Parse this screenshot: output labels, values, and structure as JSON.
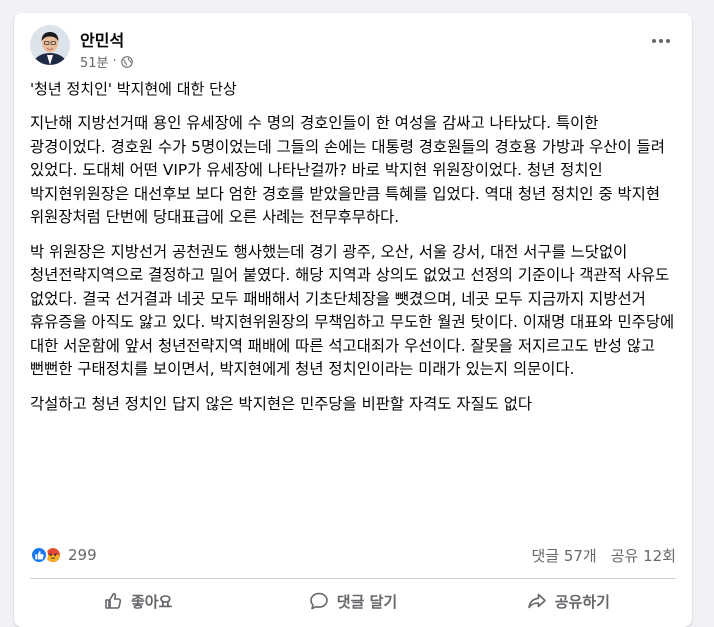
{
  "post": {
    "author": "안민석",
    "time": "51분",
    "separator": "·",
    "title": "'청년 정치인' 박지현에 대한 단상",
    "paragraphs": [
      "지난해 지방선거때 용인 유세장에 수 명의 경호인들이 한 여성을 감싸고 나타났다. 특이한 광경이었다. 경호원 수가 5명이었는데 그들의 손에는 대통령 경호원들의 경호용 가방과 우산이 들려 있었다. 도대체 어떤 VIP가 유세장에 나타난걸까? 바로 박지현 위원장이었다. 청년 정치인 박지현위원장은 대선후보 보다 엄한 경호를 받았을만큼 특혜를 입었다. 역대 청년 정치인 중 박지현 위원장처럼 단번에 당대표급에 오른 사례는 전무후무하다.",
      "박 위원장은 지방선거 공천권도 행사했는데 경기 광주, 오산, 서울 강서, 대전 서구를 느닷없이 청년전략지역으로 결정하고 밀어 붙였다. 해당 지역과 상의도 없었고 선정의 기준이나 객관적 사유도 없었다. 결국 선거결과 네곳 모두 패배해서 기초단체장을 뺏겼으며, 네곳 모두 지금까지 지방선거 휴유증을 아직도 앓고 있다. 박지현위원장의 무책임하고 무도한 월권 탓이다. 이재명 대표와 민주당에 대한 서운함에 앞서 청년전략지역 패배에 따른 석고대죄가 우선이다. 잘못을 저지르고도 반성 않고 뻔뻔한 구태정치를 보이면서, 박지현에게 청년 정치인이라는 미래가 있는지 의문이다.",
      "각설하고 청년 정치인 답지 않은 박지현은 민주당을 비판할 자격도 자질도 없다"
    ]
  },
  "stats": {
    "reactions": "299",
    "comments": "댓글 57개",
    "shares": "공유 12회"
  },
  "actions": {
    "like": "좋아요",
    "comment": "댓글 달기",
    "share": "공유하기"
  },
  "icons": {
    "privacy": "globe-icon",
    "more": "more-options-icon",
    "like_reaction": "like-reaction-icon",
    "angry_reaction": "angry-reaction-icon",
    "like_action": "thumbs-up-icon",
    "comment_action": "comment-bubble-icon",
    "share_action": "share-arrow-icon"
  },
  "colors": {
    "like_blue": "#1877f2",
    "angry_orange": "#e9710f",
    "secondary_text": "#65676b",
    "background": "#f0f2f5"
  }
}
